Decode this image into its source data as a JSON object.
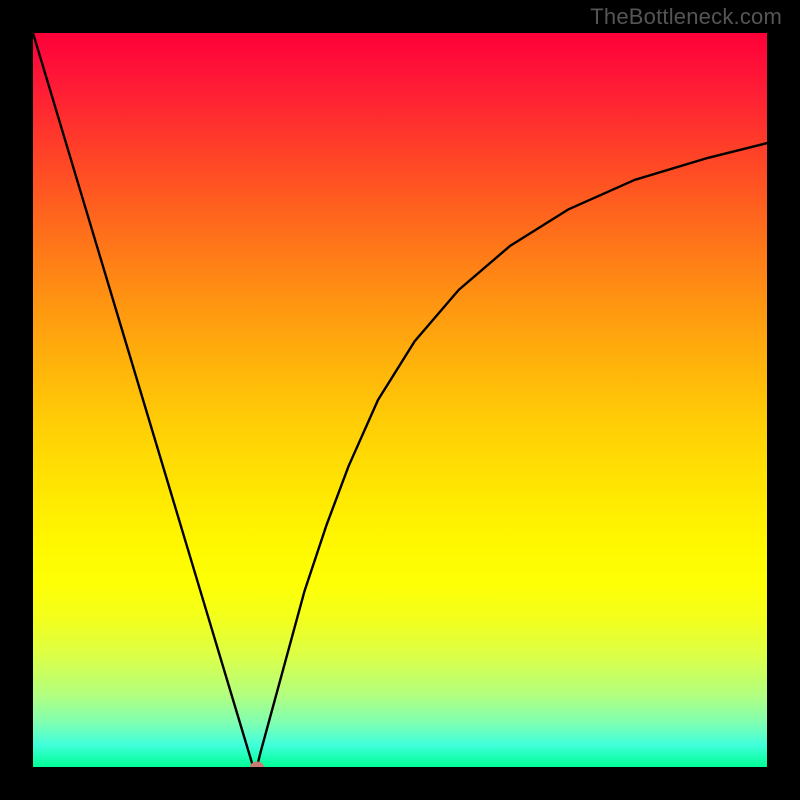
{
  "watermark": "TheBottleneck.com",
  "chart_data": {
    "type": "line",
    "title": "",
    "xlabel": "",
    "ylabel": "",
    "xlim": [
      0,
      100
    ],
    "ylim": [
      0,
      100
    ],
    "grid": false,
    "legend": false,
    "background_gradient": {
      "top": "#ff0039",
      "bottom": "#00ff95",
      "direction": "vertical"
    },
    "series": [
      {
        "name": "bottleneck-curve",
        "color": "#000000",
        "x": [
          0,
          3,
          6,
          9,
          12,
          15,
          18,
          21,
          24,
          27,
          30,
          30.5,
          31,
          34,
          37,
          40,
          43,
          47,
          52,
          58,
          65,
          73,
          82,
          92,
          100
        ],
        "y": [
          100,
          90,
          80,
          70,
          60,
          50,
          40,
          30,
          20,
          10,
          0,
          0,
          2,
          13,
          24,
          33,
          41,
          50,
          58,
          65,
          71,
          76,
          80,
          83,
          85
        ]
      }
    ],
    "annotations": [
      {
        "name": "optimal-marker",
        "shape": "ellipse",
        "color": "#c87a74",
        "x": 30.5,
        "y": 0
      }
    ]
  }
}
